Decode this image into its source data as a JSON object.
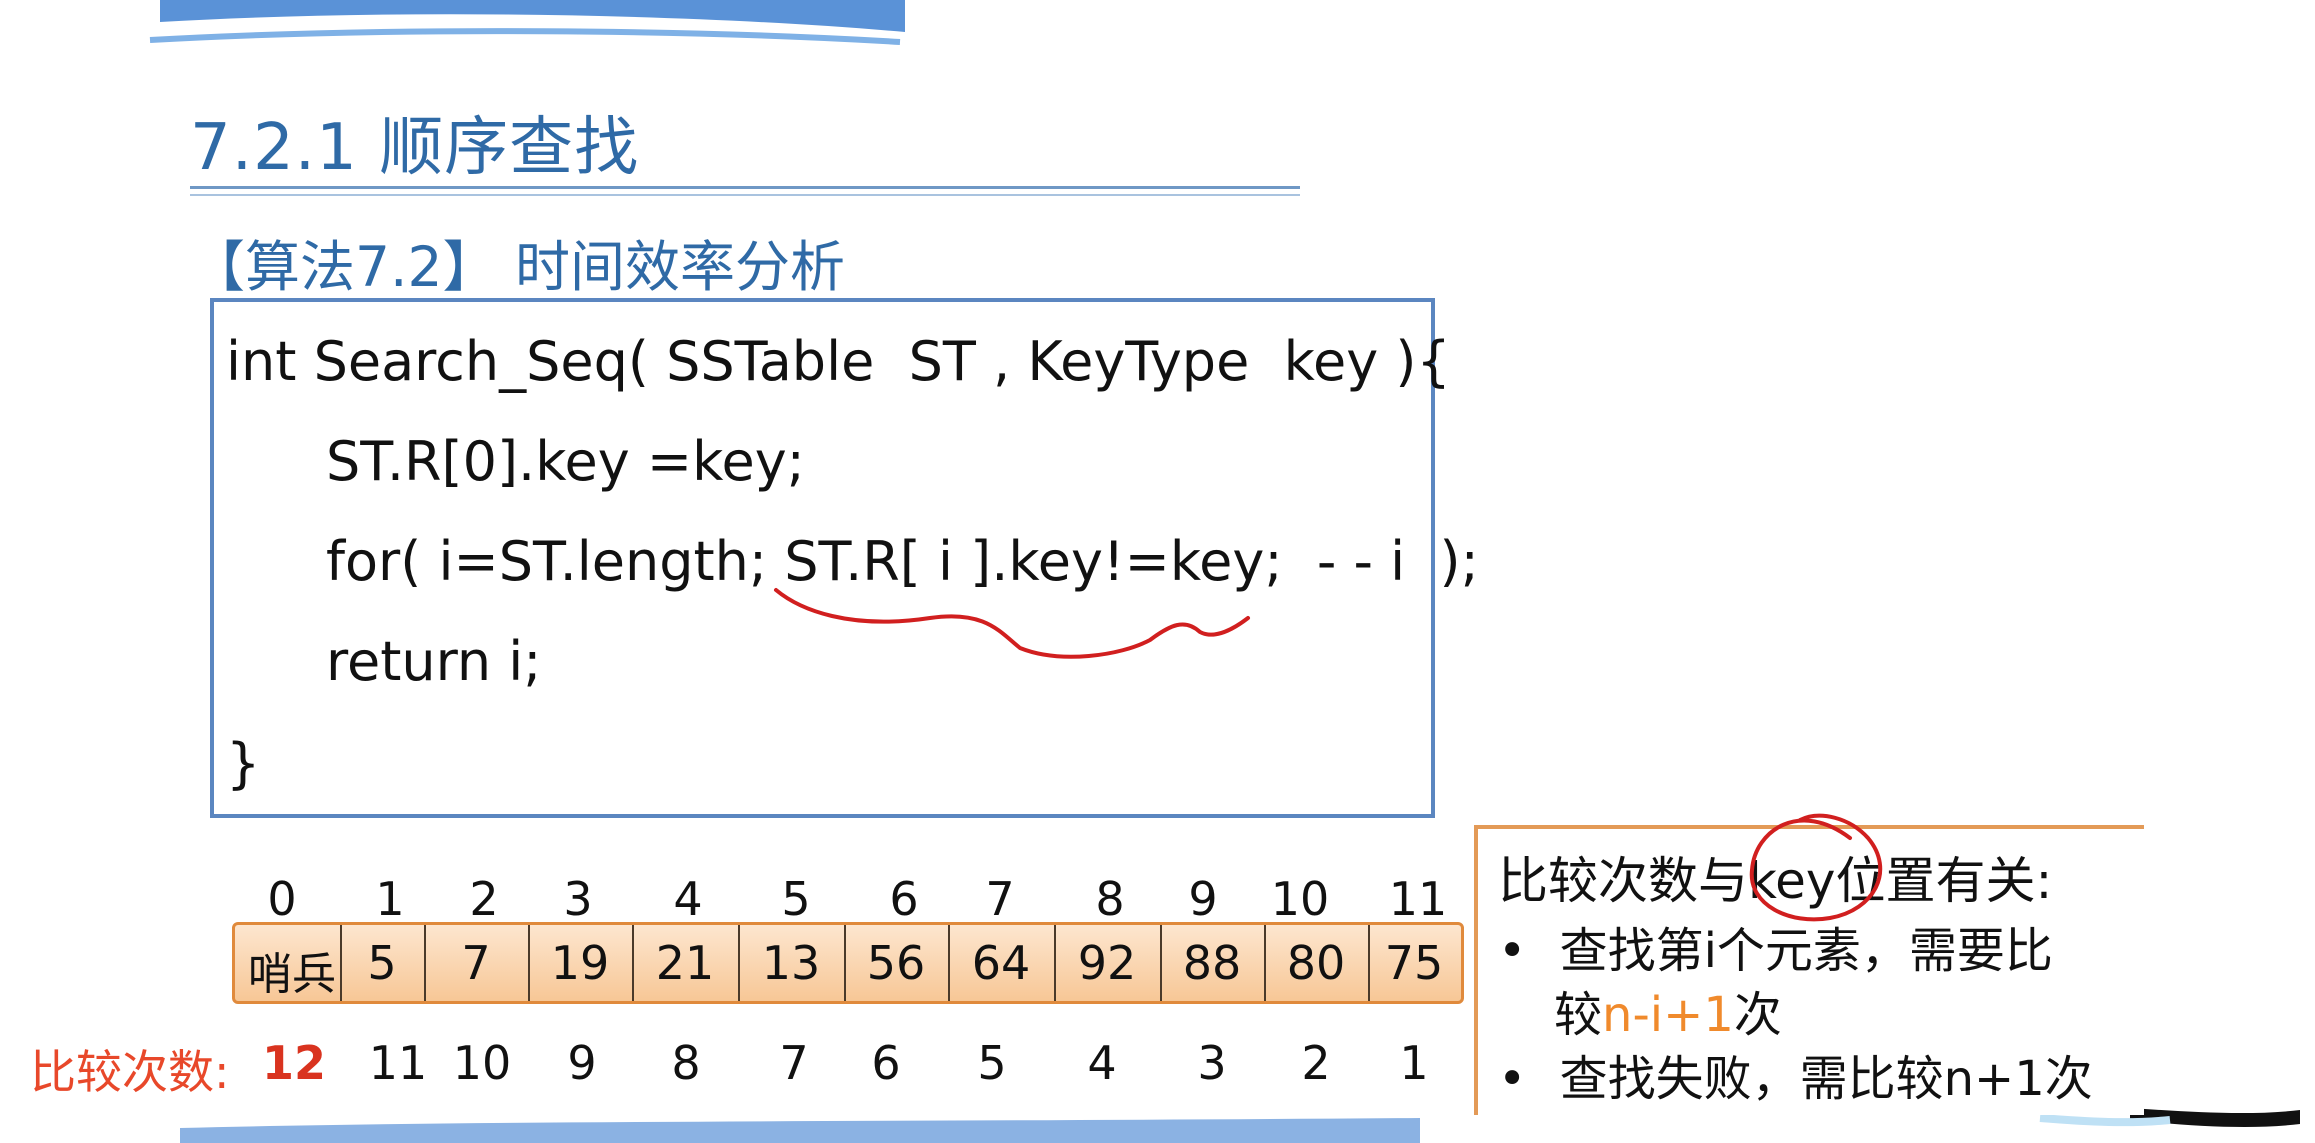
{
  "slide": {
    "title": "7.2.1 顺序查找",
    "subtitle": "【算法7.2】 时间效率分析"
  },
  "code": {
    "lines": [
      "int Search_Seq( SSTable  ST , KeyType  key ){",
      "ST.R[0].key =key;",
      "for( i=ST.length; ST.R[ i ].key!=key;  - - i  );",
      "return i;",
      "}"
    ]
  },
  "array": {
    "indices": [
      "0",
      "1",
      "2",
      "3",
      "4",
      "5",
      "6",
      "7",
      "8",
      "9",
      "10",
      "11"
    ],
    "sentinel_label": "哨兵",
    "values": [
      "5",
      "7",
      "19",
      "21",
      "13",
      "56",
      "64",
      "92",
      "88",
      "80",
      "75"
    ],
    "comparisons_label": "比较次数:",
    "comparisons": [
      "12",
      "11",
      "10",
      "9",
      "8",
      "7",
      "6",
      "5",
      "4",
      "3",
      "2",
      "1"
    ]
  },
  "note": {
    "heading": "比较次数与key位置有关:",
    "bullet_symbol": "•",
    "bullet1_line1": "查找第i个元素，需要比",
    "bullet1_line2_prefix": "较",
    "bullet1_line2_formula": "n-i+1",
    "bullet1_line2_suffix": "次",
    "bullet2": "查找失败，需比较n+1次"
  },
  "colors": {
    "title_blue": "#2f6aa6",
    "code_border": "#5b86c0",
    "array_fill": "#f7c796",
    "array_border": "#e08a3c",
    "comparison_label": "#e8482a",
    "formula_orange": "#f08a2c",
    "ink_red": "#d11f1f"
  }
}
